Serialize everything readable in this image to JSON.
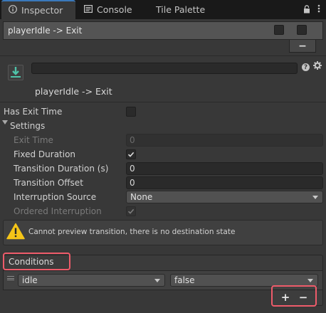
{
  "tabs": [
    {
      "label": "Inspector",
      "icon": "info-icon"
    },
    {
      "label": "Console",
      "icon": "console-icon"
    },
    {
      "label": "Tile Palette",
      "icon": ""
    }
  ],
  "transition_list": {
    "item_label": "playerIdle -> Exit",
    "remove_label": "−"
  },
  "header": {
    "title": "playerIdle -> Exit",
    "help_label": "?",
    "name_value": ""
  },
  "properties": {
    "has_exit_time": {
      "label": "Has Exit Time",
      "checked": false
    },
    "settings": {
      "label": "Settings",
      "expanded": true
    },
    "exit_time": {
      "label": "Exit Time",
      "value": "0"
    },
    "fixed_duration": {
      "label": "Fixed Duration",
      "checked": true
    },
    "transition_duration": {
      "label": "Transition Duration (s)",
      "value": "0"
    },
    "transition_offset": {
      "label": "Transition Offset",
      "value": "0"
    },
    "interruption_source": {
      "label": "Interruption Source",
      "value": "None"
    },
    "ordered_interruption": {
      "label": "Ordered Interruption",
      "checked": true
    }
  },
  "warning": {
    "text": "Cannot preview transition, there is no destination state"
  },
  "conditions": {
    "title": "Conditions",
    "items": [
      {
        "parameter": "idle",
        "value": "false"
      }
    ],
    "add_label": "+",
    "remove_label": "−"
  },
  "colors": {
    "accent_tab": "#3a79bb",
    "highlight": "#ee5b6a",
    "warning": "#f5c518",
    "transition_icon": "#4fc3a9"
  }
}
